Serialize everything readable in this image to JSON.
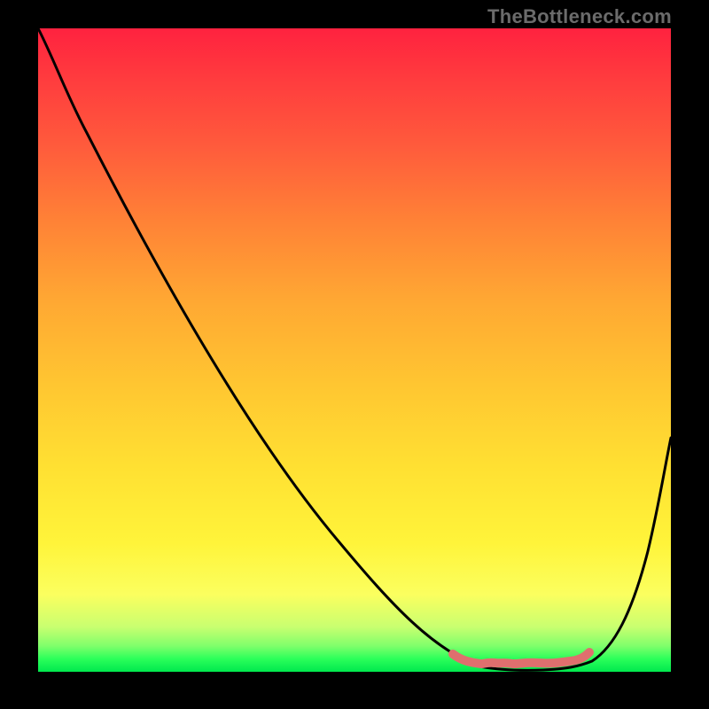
{
  "watermark": "TheBottleneck.com",
  "chart_data": {
    "type": "line",
    "title": "",
    "xlabel": "",
    "ylabel": "",
    "xlim": [
      0,
      100
    ],
    "ylim": [
      0,
      100
    ],
    "grid": false,
    "legend": false,
    "series": [
      {
        "name": "main-curve",
        "color": "#000000",
        "x": [
          0,
          5,
          10,
          20,
          30,
          40,
          50,
          60,
          66,
          70,
          74,
          78,
          82,
          86,
          90,
          95,
          100
        ],
        "y": [
          100,
          93,
          85,
          70,
          55,
          40,
          25,
          12,
          4,
          1,
          0,
          0,
          0,
          1,
          6,
          18,
          36
        ]
      },
      {
        "name": "marker-band",
        "color": "#e07070",
        "x": [
          66,
          70,
          73,
          74,
          75,
          76,
          79,
          80,
          84,
          87
        ],
        "y": [
          2.5,
          1,
          1,
          1,
          1,
          1,
          1,
          1,
          1,
          2.5
        ]
      }
    ],
    "gradient_stops": [
      {
        "pos": 0.0,
        "color": "#ff223f"
      },
      {
        "pos": 0.3,
        "color": "#ff8236"
      },
      {
        "pos": 0.68,
        "color": "#ffe032"
      },
      {
        "pos": 0.88,
        "color": "#fbff5f"
      },
      {
        "pos": 0.96,
        "color": "#7fff6b"
      },
      {
        "pos": 1.0,
        "color": "#00e84e"
      }
    ]
  }
}
